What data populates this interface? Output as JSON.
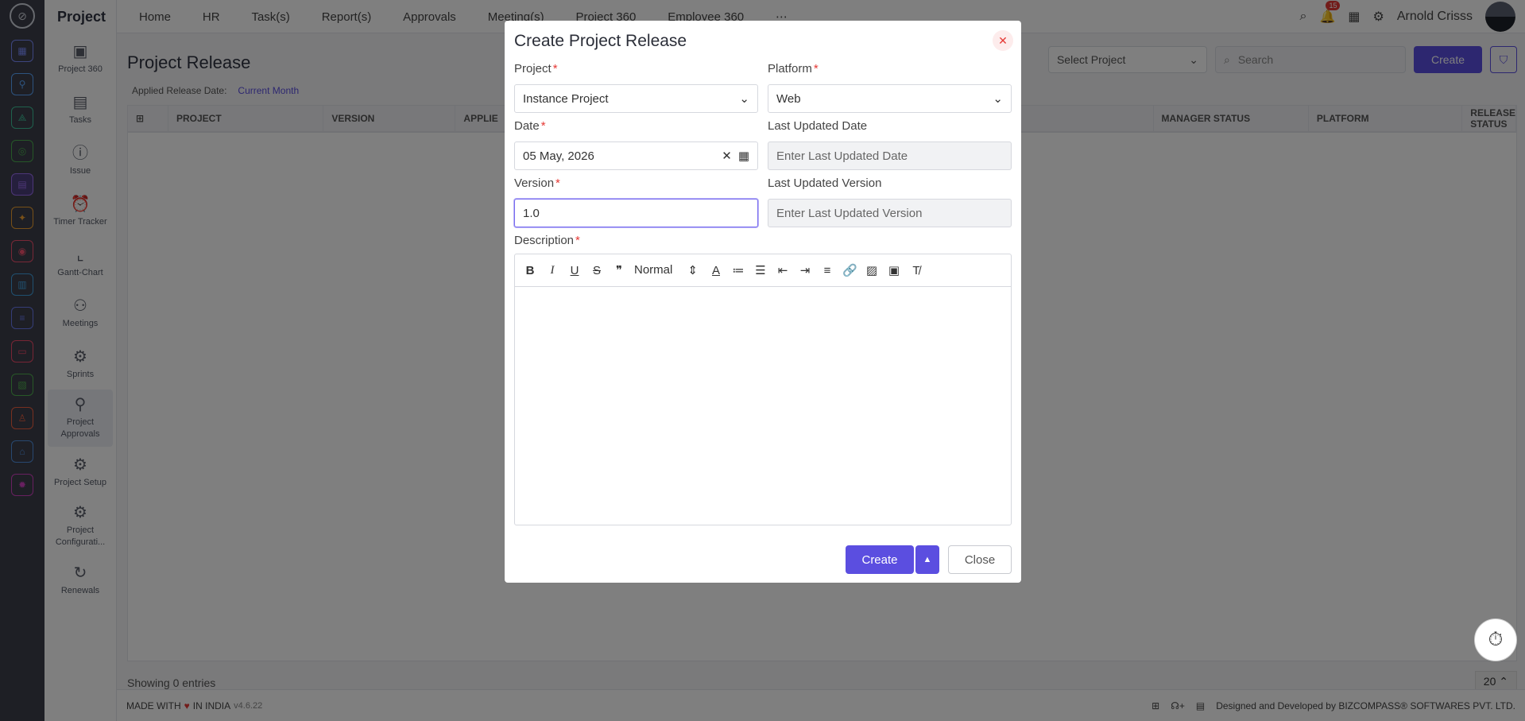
{
  "app": {
    "name": "Project"
  },
  "topnav": [
    "Home",
    "HR",
    "Task(s)",
    "Report(s)",
    "Approvals",
    "Meeting(s)",
    "Project 360",
    "Employee 360"
  ],
  "user": {
    "name": "Arnold Crisss",
    "notifications": "15"
  },
  "sidenav": [
    {
      "label": "Project 360",
      "icon": "briefcase-icon"
    },
    {
      "label": "Tasks",
      "icon": "clipboard-icon"
    },
    {
      "label": "Issue",
      "icon": "alert-icon"
    },
    {
      "label": "Timer Tracker",
      "icon": "alarm-icon"
    },
    {
      "label": "Gantt-Chart",
      "icon": "chart-icon"
    },
    {
      "label": "Meetings",
      "icon": "meeting-icon"
    },
    {
      "label": "Sprints",
      "icon": "gear-icon"
    },
    {
      "label": "Project Approvals",
      "icon": "approval-icon"
    },
    {
      "label": "Project Setup",
      "icon": "gear-icon"
    },
    {
      "label": "Project Configurati...",
      "icon": "gear-icon"
    },
    {
      "label": "Renewals",
      "icon": "refresh-icon"
    }
  ],
  "page": {
    "title": "Project Release",
    "applied_label": "Applied Release Date:",
    "applied_value": "Current Month",
    "select_project": "Select Project",
    "search_placeholder": "Search",
    "create_label": "Create",
    "columns": [
      "PROJECT",
      "VERSION",
      "APPLIE",
      "MANAGER STATUS",
      "PLATFORM",
      "RELEASE STATUS"
    ],
    "showing": "Showing 0 entries",
    "page_size": "20"
  },
  "footer": {
    "made_with": "MADE WITH",
    "in_india": "IN INDIA",
    "version": "v4.6.22",
    "designed_by": "Designed and Developed by",
    "company": "BIZCOMPASS",
    "company_suffix": "SOFTWARES PVT. LTD."
  },
  "modal": {
    "title": "Create Project Release",
    "project": {
      "label": "Project",
      "value": "Instance Project"
    },
    "platform": {
      "label": "Platform",
      "value": "Web"
    },
    "date": {
      "label": "Date",
      "value": "05 May, 2026"
    },
    "last_updated_date": {
      "label": "Last Updated Date",
      "placeholder": "Enter Last Updated Date"
    },
    "version": {
      "label": "Version",
      "value": "1.0"
    },
    "last_updated_version": {
      "label": "Last Updated Version",
      "placeholder": "Enter Last Updated Version"
    },
    "description": {
      "label": "Description",
      "format": "Normal"
    },
    "create_button": "Create",
    "close_button": "Close"
  }
}
